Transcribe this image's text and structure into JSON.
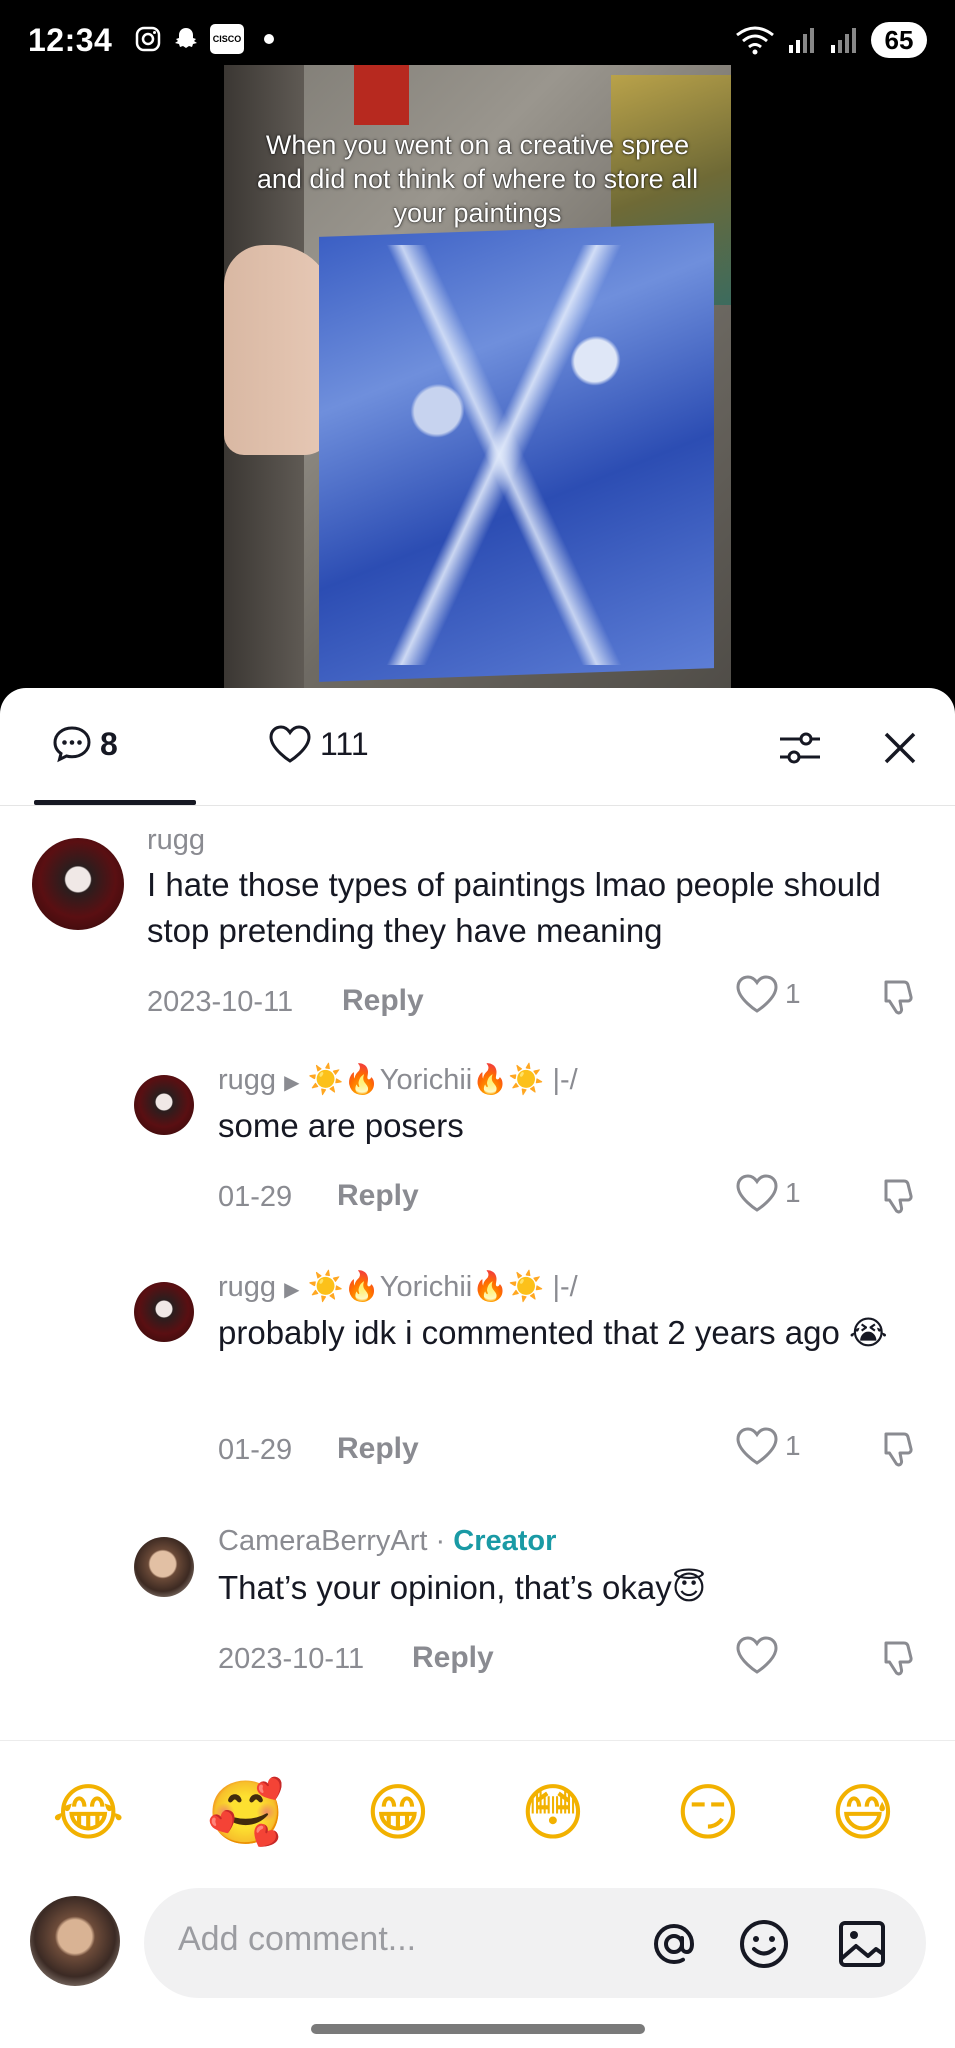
{
  "status_bar": {
    "time": "12:34",
    "battery": "65"
  },
  "video": {
    "caption": "When you went on a creative spree and did not think of where to store all your paintings"
  },
  "sheet": {
    "comments_count": "8",
    "likes_count": "111"
  },
  "comments": [
    {
      "user": "rugg",
      "text": "I hate those types of paintings lmao people should stop pretending they have meaning",
      "date": "2023-10-11",
      "reply_label": "Reply",
      "likes": "1"
    },
    {
      "user": "rugg",
      "reply_to": "☀️🔥Yorichii🔥☀️ |-/",
      "text": "some are posers",
      "date": "01-29",
      "reply_label": "Reply",
      "likes": "1"
    },
    {
      "user": "rugg",
      "reply_to": "☀️🔥Yorichii🔥☀️ |-/",
      "text": "probably idk i commented that 2 years ago 😭",
      "date": "01-29",
      "reply_label": "Reply",
      "likes": "1"
    },
    {
      "user": "CameraBerryArt",
      "badge_sep": " · ",
      "badge": "Creator",
      "text": "That’s your opinion, that’s okay😇",
      "date": "2023-10-11",
      "reply_label": "Reply",
      "likes": ""
    }
  ],
  "emoji_bar": [
    "😂",
    "🥰",
    "😁",
    "😳",
    "😏",
    "😅"
  ],
  "input": {
    "placeholder": "Add comment..."
  },
  "icons": {
    "comment": "comment-bubble-icon",
    "like": "heart-icon",
    "filter": "filter-sliders-icon",
    "close": "close-icon",
    "dislike": "thumbs-down-icon",
    "mention": "at-icon",
    "emoji": "smiley-icon",
    "image": "image-icon"
  }
}
